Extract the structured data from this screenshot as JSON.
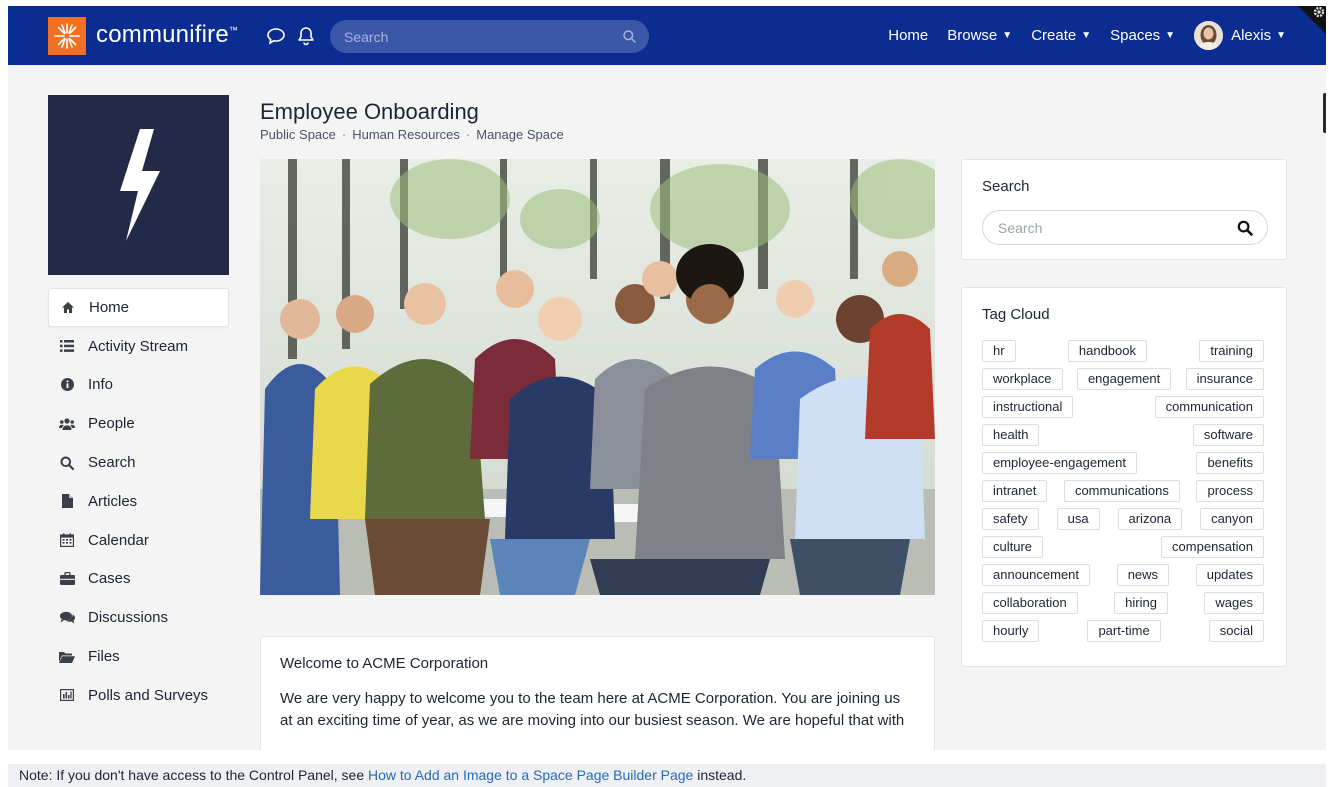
{
  "colors": {
    "topbar": "#0b2d91",
    "accent": "#f36f21",
    "space_logo_bg": "#222a47",
    "link": "#2a6ab4"
  },
  "topbar": {
    "brand": "communifire",
    "brand_mark": "™",
    "search_placeholder": "Search",
    "nav": [
      {
        "label": "Home",
        "caret": false
      },
      {
        "label": "Browse",
        "caret": true
      },
      {
        "label": "Create",
        "caret": true
      },
      {
        "label": "Spaces",
        "caret": true
      },
      {
        "label": "Alexis",
        "caret": true
      }
    ],
    "icons": [
      "chat-bubble-icon",
      "bell-icon",
      "search-icon",
      "gear-icon"
    ]
  },
  "sidebar": {
    "items": [
      {
        "label": "Home",
        "icon": "home-icon"
      },
      {
        "label": "Activity Stream",
        "icon": "list-icon"
      },
      {
        "label": "Info",
        "icon": "info-icon"
      },
      {
        "label": "People",
        "icon": "people-icon"
      },
      {
        "label": "Search",
        "icon": "search-icon"
      },
      {
        "label": "Articles",
        "icon": "document-icon"
      },
      {
        "label": "Calendar",
        "icon": "calendar-icon"
      },
      {
        "label": "Cases",
        "icon": "briefcase-icon"
      },
      {
        "label": "Discussions",
        "icon": "comments-icon"
      },
      {
        "label": "Files",
        "icon": "folder-icon"
      },
      {
        "label": "Polls and Surveys",
        "icon": "bar-chart-icon"
      }
    ]
  },
  "main": {
    "title": "Employee Onboarding",
    "breadcrumb": [
      "Public Space",
      "Human Resources",
      "Manage Space"
    ],
    "welcome": {
      "heading": "Welcome to ACME Corporation",
      "body": "We are very happy to welcome you to the team here at ACME Corporation. You are joining us at an exciting time of year, as we are moving into our busiest season. We are hopeful that with"
    }
  },
  "right": {
    "search": {
      "title": "Search",
      "placeholder": "Search"
    },
    "tag_cloud": {
      "title": "Tag Cloud",
      "rows": [
        [
          "hr",
          "handbook",
          "training"
        ],
        [
          "workplace",
          "engagement",
          "insurance"
        ],
        [
          "instructional",
          "communication"
        ],
        [
          "health",
          "software"
        ],
        [
          "employee-engagement",
          "benefits"
        ],
        [
          "intranet",
          "communications",
          "process"
        ],
        [
          "safety",
          "usa",
          "arizona",
          "canyon"
        ],
        [
          "culture",
          "compensation"
        ],
        [
          "announcement",
          "news",
          "updates"
        ],
        [
          "collaboration",
          "hiring",
          "wages"
        ],
        [
          "hourly",
          "part-time",
          "social"
        ]
      ]
    }
  },
  "note": {
    "prefix": "Note: If you don't have access to the Control Panel, see ",
    "link": "How to Add an Image to a Space Page Builder Page",
    "suffix": " instead."
  }
}
